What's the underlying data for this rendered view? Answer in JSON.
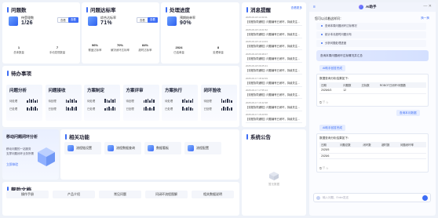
{
  "kpis": [
    {
      "title": "问题数",
      "card_title": "待受理数",
      "big_value": "1/26",
      "btn_outline": "查看",
      "btn_fill": "查看",
      "stats": [
        {
          "value": "1",
          "label": "总体数量"
        },
        {
          "value": "7",
          "label": "手动发现数量"
        }
      ]
    },
    {
      "title": "问题达标率",
      "card_title": "综合达标率",
      "big_value": "71%",
      "btn_outline": "查看",
      "btn_fill": "查看",
      "stats": [
        {
          "value": "96%",
          "label": "覆盖达标率"
        },
        {
          "value": "70%",
          "label": "解决闭环达标率"
        },
        {
          "value": "84%",
          "label": "超时达标率"
        }
      ]
    },
    {
      "title": "处理进度",
      "card_title": "预期结单率",
      "big_value": "90%",
      "btn_outline": "",
      "stats": [
        {
          "value": "2024",
          "label": "已结单量"
        },
        {
          "value": "8",
          "label": "处理单量"
        }
      ]
    }
  ],
  "pending": {
    "title": "待办事项",
    "items": [
      {
        "name": "问题分析",
        "r1": "待处理",
        "r2": "已处理"
      },
      {
        "name": "问题接收",
        "r1": "待处理",
        "r2": "已处理"
      },
      {
        "name": "方案制定",
        "r1": "待处理",
        "r2": "已处理"
      },
      {
        "name": "方案评审",
        "r1": "待处理",
        "r2": "已处理"
      },
      {
        "name": "方案执行",
        "r1": "待处理",
        "r2": "已处理"
      },
      {
        "name": "闭环验收",
        "r1": "待处理",
        "r2": "已处理"
      }
    ]
  },
  "promo": {
    "title": "移动问题闭环分析",
    "line1": "移动问题的一站服务",
    "line2": "支撑问题闭环业务所需",
    "link": "立即体验"
  },
  "functions": {
    "title": "相关功能",
    "items": [
      "流程链设置",
      "流程数据查询",
      "数据看板",
      "流程配置"
    ]
  },
  "help": {
    "title": "帮助文档",
    "items": [
      "操作手册",
      "产品介绍",
      "常见问题",
      "问闭环流程图解",
      "相关数据说明"
    ]
  },
  "tasks": {
    "title": "消息提醒",
    "action": "查看更多",
    "items": [
      {
        "date": "2025-06-18 11:00:31",
        "text": "【流程协同通知】问题编号已闭环，持续关注..."
      },
      {
        "date": "2025-06-18 10:21:52",
        "text": "【流程协同通知】问题编号已闭环，持续关注..."
      },
      {
        "date": "2025-06-18 10:14:03",
        "text": "【流程协同通知】问题编号已闭环，持续关注..."
      },
      {
        "date": "2025-06-18 09:48:27",
        "text": "【流程协同通知】问题编号已闭环，持续关注..."
      },
      {
        "date": "2025-06-18 09:25:41",
        "text": "【流程协同通知】问题编号已闭环，持续关注..."
      },
      {
        "date": "2025-06-17 18:32:09",
        "text": "【流程协同通知】问题编号已闭环，持续关注..."
      },
      {
        "date": "2025-06-17 17:55:14",
        "text": "【流程协同通知】问题编号已闭环，持续关注..."
      },
      {
        "date": "2025-06-17 16:42:38",
        "text": "【流程协同通知】问题编号已闭环，持续关注..."
      },
      {
        "date": "2025-06-17 15:20:56",
        "text": "【流程协同通知】问题编号已闭环，持续关注..."
      }
    ]
  },
  "notice": {
    "title": "系统公告",
    "empty": "暂无数据"
  },
  "assistant": {
    "title": "AI助手",
    "hint": "您可以试着这样问：",
    "refresh": "换一换",
    "suggestions": [
      "查询本周问题闭环达标情况",
      "统计本月超时问题分布",
      "分析问题处理进度"
    ],
    "query": "查询本周问题闭环达标情况并汇总",
    "answer1_head": "AI助手回答完成",
    "answer1_label": "数据查询分析结果如下：",
    "table1_head": [
      "日期",
      "问题数",
      "达标数",
      "ROBOT已闭环/问题数"
    ],
    "table1_row": [
      "2025/6/3",
      "12",
      "",
      ""
    ],
    "query2": "查询本月数据",
    "answer2_head": "AI助手回答完成",
    "answer2_label": "数据查询分析结果如下：",
    "table2_head": [
      "日期",
      "问题总数",
      "闭环数",
      "超时数",
      "问题闭环率"
    ],
    "table2_rows": [
      [
        "2025/5",
        "",
        "",
        "",
        ""
      ],
      [
        "2025/6",
        "",
        "",
        "",
        ""
      ]
    ],
    "input_placeholder": "输入问题，Enter发送"
  }
}
